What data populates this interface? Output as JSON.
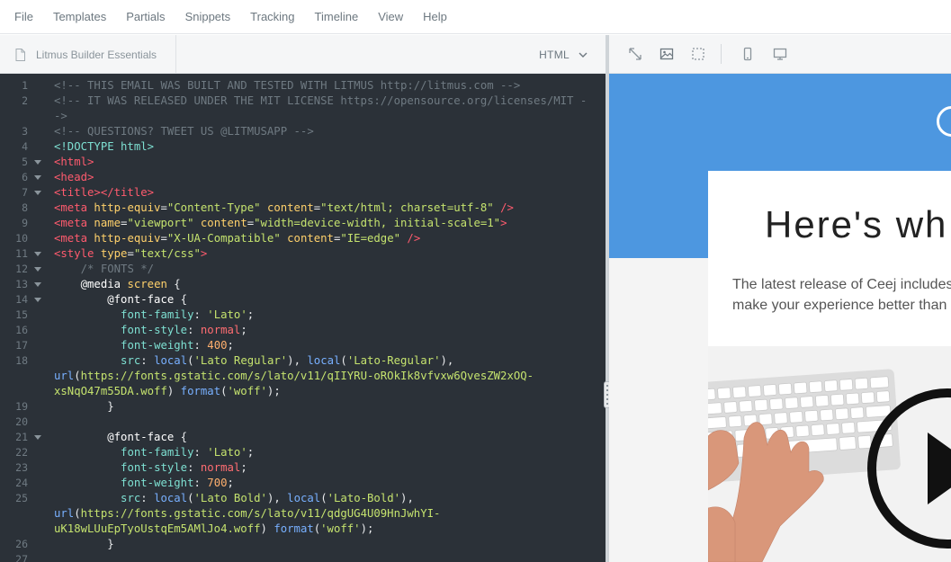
{
  "menu": [
    "File",
    "Templates",
    "Partials",
    "Snippets",
    "Tracking",
    "Timeline",
    "View",
    "Help"
  ],
  "editor": {
    "file_name": "Litmus Builder Essentials",
    "language": "HTML"
  },
  "code_lines": [
    {
      "n": "1",
      "fold": false,
      "tokens": [
        [
          "com",
          "<!-- THIS EMAIL WAS BUILT AND TESTED WITH LITMUS http://litmus.com -->"
        ]
      ]
    },
    {
      "n": "2",
      "fold": false,
      "tokens": [
        [
          "com",
          "<!-- IT WAS RELEASED UNDER THE MIT LICENSE https://opensource.org/licenses/MIT -"
        ]
      ]
    },
    {
      "n": "",
      "fold": false,
      "tokens": [
        [
          "com",
          "->"
        ]
      ]
    },
    {
      "n": "3",
      "fold": false,
      "tokens": [
        [
          "com",
          "<!-- QUESTIONS? TWEET US @LITMUSAPP -->"
        ]
      ]
    },
    {
      "n": "4",
      "fold": false,
      "tokens": [
        [
          "prop",
          "<!DOCTYPE html>"
        ]
      ]
    },
    {
      "n": "5",
      "fold": true,
      "tokens": [
        [
          "tag",
          "<html>"
        ]
      ]
    },
    {
      "n": "6",
      "fold": true,
      "tokens": [
        [
          "tag",
          "<head>"
        ]
      ]
    },
    {
      "n": "7",
      "fold": true,
      "tokens": [
        [
          "tag",
          "<title></title>"
        ]
      ]
    },
    {
      "n": "8",
      "fold": false,
      "tokens": [
        [
          "tag",
          "<meta "
        ],
        [
          "attr",
          "http-equiv"
        ],
        [
          "pl",
          "="
        ],
        [
          "str",
          "\"Content-Type\""
        ],
        [
          "pl",
          " "
        ],
        [
          "attr",
          "content"
        ],
        [
          "pl",
          "="
        ],
        [
          "str",
          "\"text/html; charset=utf-8\""
        ],
        [
          "pl",
          " "
        ],
        [
          "tag",
          "/>"
        ]
      ]
    },
    {
      "n": "9",
      "fold": false,
      "tokens": [
        [
          "tag",
          "<meta "
        ],
        [
          "attr",
          "name"
        ],
        [
          "pl",
          "="
        ],
        [
          "str",
          "\"viewport\""
        ],
        [
          "pl",
          " "
        ],
        [
          "attr",
          "content"
        ],
        [
          "pl",
          "="
        ],
        [
          "str",
          "\"width=device-width, initial-scale=1\""
        ],
        [
          "tag",
          ">"
        ]
      ]
    },
    {
      "n": "10",
      "fold": false,
      "tokens": [
        [
          "tag",
          "<meta "
        ],
        [
          "attr",
          "http-equiv"
        ],
        [
          "pl",
          "="
        ],
        [
          "str",
          "\"X-UA-Compatible\""
        ],
        [
          "pl",
          " "
        ],
        [
          "attr",
          "content"
        ],
        [
          "pl",
          "="
        ],
        [
          "str",
          "\"IE=edge\""
        ],
        [
          "pl",
          " "
        ],
        [
          "tag",
          "/>"
        ]
      ]
    },
    {
      "n": "11",
      "fold": true,
      "tokens": [
        [
          "tag",
          "<style "
        ],
        [
          "attr",
          "type"
        ],
        [
          "pl",
          "="
        ],
        [
          "str",
          "\"text/css\""
        ],
        [
          "tag",
          ">"
        ]
      ]
    },
    {
      "n": "12",
      "fold": true,
      "tokens": [
        [
          "pl",
          "    "
        ],
        [
          "com",
          "/* FONTS */"
        ]
      ]
    },
    {
      "n": "13",
      "fold": true,
      "tokens": [
        [
          "pl",
          "    "
        ],
        [
          "kw",
          "@media"
        ],
        [
          "pl",
          " "
        ],
        [
          "attr",
          "screen"
        ],
        [
          "pl",
          " {"
        ]
      ]
    },
    {
      "n": "14",
      "fold": true,
      "tokens": [
        [
          "pl",
          "        "
        ],
        [
          "kw",
          "@font-face"
        ],
        [
          "pl",
          " {"
        ]
      ]
    },
    {
      "n": "15",
      "fold": false,
      "tokens": [
        [
          "pl",
          "          "
        ],
        [
          "prop",
          "font-family"
        ],
        [
          "pl",
          ": "
        ],
        [
          "str",
          "'Lato'"
        ],
        [
          "pl",
          ";"
        ]
      ]
    },
    {
      "n": "16",
      "fold": false,
      "tokens": [
        [
          "pl",
          "          "
        ],
        [
          "prop",
          "font-style"
        ],
        [
          "pl",
          ": "
        ],
        [
          "val",
          "normal"
        ],
        [
          "pl",
          ";"
        ]
      ]
    },
    {
      "n": "17",
      "fold": false,
      "tokens": [
        [
          "pl",
          "          "
        ],
        [
          "prop",
          "font-weight"
        ],
        [
          "pl",
          ": "
        ],
        [
          "num",
          "400"
        ],
        [
          "pl",
          ";"
        ]
      ]
    },
    {
      "n": "18",
      "fold": false,
      "tokens": [
        [
          "pl",
          "          "
        ],
        [
          "prop",
          "src"
        ],
        [
          "pl",
          ": "
        ],
        [
          "fn",
          "local"
        ],
        [
          "pl",
          "("
        ],
        [
          "str",
          "'Lato Regular'"
        ],
        [
          "pl",
          "), "
        ],
        [
          "fn",
          "local"
        ],
        [
          "pl",
          "("
        ],
        [
          "str",
          "'Lato-Regular'"
        ],
        [
          "pl",
          "),"
        ]
      ]
    },
    {
      "n": "",
      "fold": false,
      "tokens": [
        [
          "fn",
          "url"
        ],
        [
          "pl",
          "("
        ],
        [
          "str",
          "https://fonts.gstatic.com/s/lato/v11/qIIYRU-oROkIk8vfvxw6QvesZW2xOQ-"
        ]
      ]
    },
    {
      "n": "",
      "fold": false,
      "tokens": [
        [
          "str",
          "xsNqO47m55DA.woff"
        ],
        [
          "pl",
          ") "
        ],
        [
          "fn",
          "format"
        ],
        [
          "pl",
          "("
        ],
        [
          "str",
          "'woff'"
        ],
        [
          "pl",
          ");"
        ]
      ]
    },
    {
      "n": "19",
      "fold": false,
      "tokens": [
        [
          "pl",
          "        }"
        ]
      ]
    },
    {
      "n": "20",
      "fold": false,
      "tokens": [
        [
          "pl",
          ""
        ]
      ]
    },
    {
      "n": "21",
      "fold": true,
      "tokens": [
        [
          "pl",
          "        "
        ],
        [
          "kw",
          "@font-face"
        ],
        [
          "pl",
          " {"
        ]
      ]
    },
    {
      "n": "22",
      "fold": false,
      "tokens": [
        [
          "pl",
          "          "
        ],
        [
          "prop",
          "font-family"
        ],
        [
          "pl",
          ": "
        ],
        [
          "str",
          "'Lato'"
        ],
        [
          "pl",
          ";"
        ]
      ]
    },
    {
      "n": "23",
      "fold": false,
      "tokens": [
        [
          "pl",
          "          "
        ],
        [
          "prop",
          "font-style"
        ],
        [
          "pl",
          ": "
        ],
        [
          "val",
          "normal"
        ],
        [
          "pl",
          ";"
        ]
      ]
    },
    {
      "n": "24",
      "fold": false,
      "tokens": [
        [
          "pl",
          "          "
        ],
        [
          "prop",
          "font-weight"
        ],
        [
          "pl",
          ": "
        ],
        [
          "num",
          "700"
        ],
        [
          "pl",
          ";"
        ]
      ]
    },
    {
      "n": "25",
      "fold": false,
      "tokens": [
        [
          "pl",
          "          "
        ],
        [
          "prop",
          "src"
        ],
        [
          "pl",
          ": "
        ],
        [
          "fn",
          "local"
        ],
        [
          "pl",
          "("
        ],
        [
          "str",
          "'Lato Bold'"
        ],
        [
          "pl",
          "), "
        ],
        [
          "fn",
          "local"
        ],
        [
          "pl",
          "("
        ],
        [
          "str",
          "'Lato-Bold'"
        ],
        [
          "pl",
          "),"
        ]
      ]
    },
    {
      "n": "",
      "fold": false,
      "tokens": [
        [
          "fn",
          "url"
        ],
        [
          "pl",
          "("
        ],
        [
          "str",
          "https://fonts.gstatic.com/s/lato/v11/qdgUG4U09HnJwhYI-"
        ]
      ]
    },
    {
      "n": "",
      "fold": false,
      "tokens": [
        [
          "str",
          "uK18wLUuEpTyoUstqEm5AMlJo4.woff"
        ],
        [
          "pl",
          ") "
        ],
        [
          "fn",
          "format"
        ],
        [
          "pl",
          "("
        ],
        [
          "str",
          "'woff'"
        ],
        [
          "pl",
          ");"
        ]
      ]
    },
    {
      "n": "26",
      "fold": false,
      "tokens": [
        [
          "pl",
          "        }"
        ]
      ]
    },
    {
      "n": "27",
      "fold": false,
      "tokens": [
        [
          "pl",
          ""
        ]
      ]
    }
  ],
  "preview": {
    "headline": "Here's wh",
    "lead_line1": "The latest release of Ceej includes",
    "lead_line2": "make your experience better than e"
  },
  "colors": {
    "editor_bg": "#2b3138",
    "hero_blue": "#4d97e0"
  },
  "toolbar_icons": [
    "expand-icon",
    "image-icon",
    "select-box-icon",
    "mobile-icon",
    "desktop-icon"
  ]
}
